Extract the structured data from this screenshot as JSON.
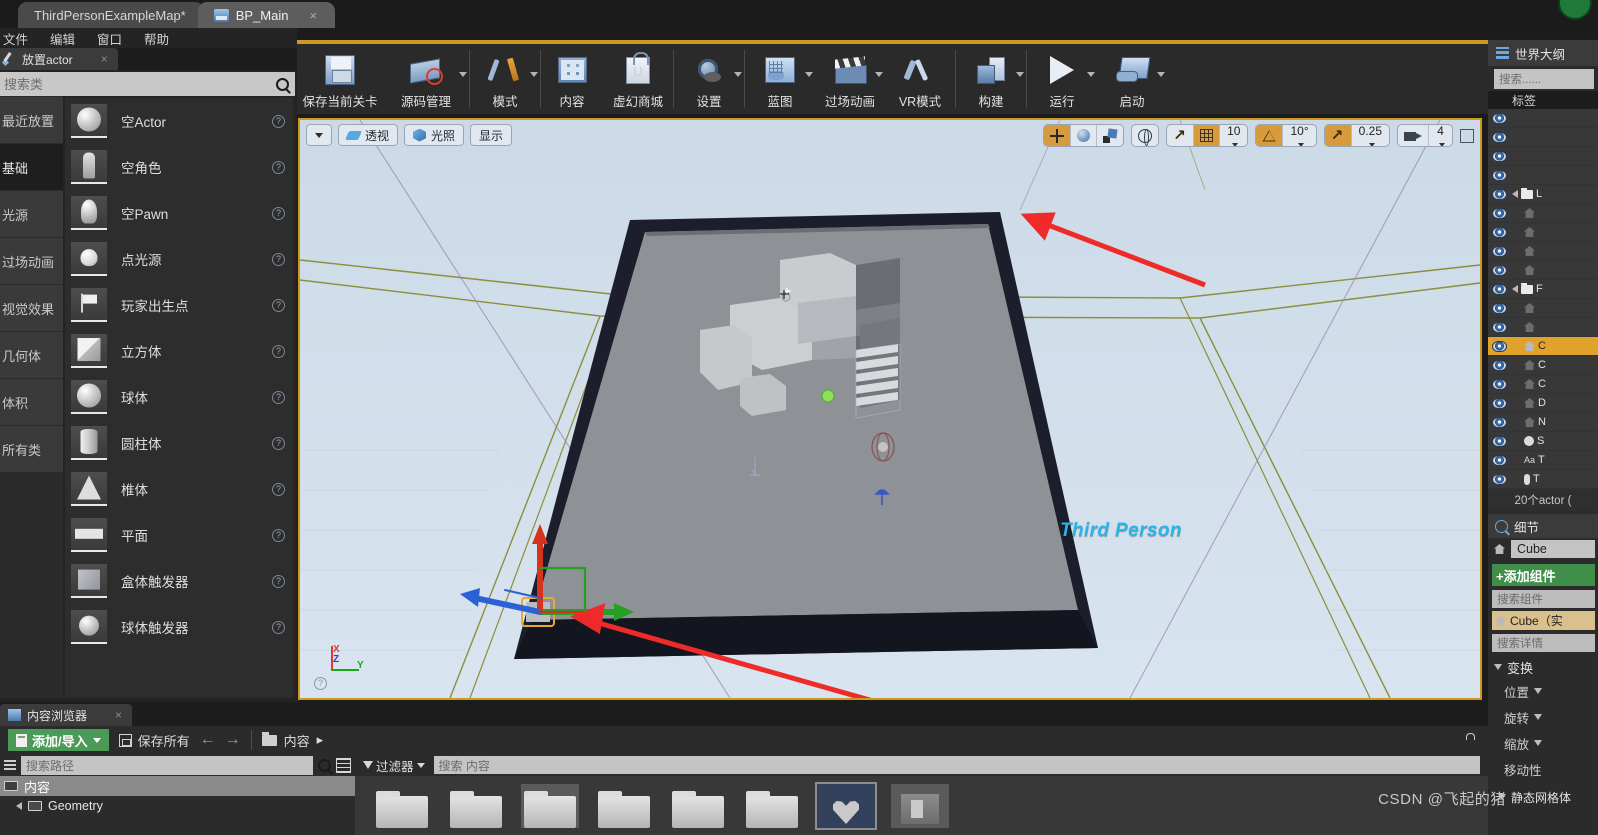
{
  "window": {
    "tabs": [
      {
        "label": "ThirdPersonExampleMap*",
        "icon": "map-tab-icon",
        "active": false,
        "close": "×"
      },
      {
        "label": "BP_Main",
        "icon": "blueprint-tab-icon",
        "active": true,
        "close": "×"
      }
    ]
  },
  "menubar": {
    "items": [
      "文件",
      "编辑",
      "窗口",
      "帮助"
    ]
  },
  "place_actors": {
    "tab_label": "放置actor",
    "tab_close": "×",
    "search_placeholder": "搜索类",
    "categories": [
      {
        "label": "最近放置",
        "selected": false
      },
      {
        "label": "基础",
        "selected": true
      },
      {
        "label": "光源",
        "selected": false
      },
      {
        "label": "过场动画",
        "selected": false
      },
      {
        "label": "视觉效果",
        "selected": false
      },
      {
        "label": "几何体",
        "selected": false
      },
      {
        "label": "体积",
        "selected": false
      },
      {
        "label": "所有类",
        "selected": false
      }
    ],
    "items": [
      {
        "label": "空Actor",
        "shape": "sphere",
        "help": "?"
      },
      {
        "label": "空角色",
        "shape": "person",
        "help": "?"
      },
      {
        "label": "空Pawn",
        "shape": "pawn",
        "help": "?"
      },
      {
        "label": "点光源",
        "shape": "bulb",
        "help": "?"
      },
      {
        "label": "玩家出生点",
        "shape": "flag",
        "help": "?"
      },
      {
        "label": "立方体",
        "shape": "cube",
        "help": "?"
      },
      {
        "label": "球体",
        "shape": "sphere",
        "help": "?"
      },
      {
        "label": "圆柱体",
        "shape": "cylinder",
        "help": "?"
      },
      {
        "label": "椎体",
        "shape": "cone",
        "help": "?"
      },
      {
        "label": "平面",
        "shape": "plane",
        "help": "?"
      },
      {
        "label": "盒体触发器",
        "shape": "box-trigger",
        "help": "?"
      },
      {
        "label": "球体触发器",
        "shape": "sphere-trigger",
        "help": "?"
      }
    ]
  },
  "toolbar": {
    "buttons": [
      {
        "label": "保存当前关卡",
        "icon": "save-level-icon",
        "caret": false
      },
      {
        "label": "源码管理",
        "icon": "source-control-icon",
        "caret": true
      },
      {
        "label": "模式",
        "icon": "modes-icon",
        "caret": true
      },
      {
        "label": "内容",
        "icon": "content-icon",
        "caret": false
      },
      {
        "label": "虚幻商城",
        "icon": "marketplace-icon",
        "caret": false
      },
      {
        "label": "设置",
        "icon": "settings-gear-icon",
        "caret": true
      },
      {
        "label": "蓝图",
        "icon": "blueprint-icon",
        "caret": true
      },
      {
        "label": "过场动画",
        "icon": "cinematics-icon",
        "caret": true
      },
      {
        "label": "VR模式",
        "icon": "vr-mode-icon",
        "caret": false
      },
      {
        "label": "构建",
        "icon": "build-icon",
        "caret": true
      },
      {
        "label": "运行",
        "icon": "play-icon",
        "caret": true
      },
      {
        "label": "启动",
        "icon": "launch-icon",
        "caret": true
      }
    ]
  },
  "viewport": {
    "left_buttons": [
      {
        "label": "",
        "icon": "chevron-down-icon"
      },
      {
        "label": "透视",
        "icon": "perspective-icon"
      },
      {
        "label": "光照",
        "icon": "lit-icon"
      },
      {
        "label": "显示",
        "icon": "show-icon"
      }
    ],
    "transform_modes": [
      {
        "icon": "move-tool-icon",
        "active": true
      },
      {
        "icon": "rotate-tool-icon",
        "active": false
      },
      {
        "icon": "scale-tool-icon",
        "active": false
      }
    ],
    "coordinate_space": {
      "icon": "world-space-globe-icon",
      "active": false
    },
    "grid_snap": {
      "icon": "grid-snap-icon",
      "value": "10",
      "active": true
    },
    "surface_snap": {
      "icon": "surface-snap-icon",
      "active": false
    },
    "rotation_snap": {
      "icon": "rotation-snap-icon",
      "value": "10°",
      "active": false
    },
    "scale_snap": {
      "icon": "scale-snap-icon",
      "value": "0.25",
      "active": true
    },
    "camera_speed": {
      "icon": "camera-speed-icon",
      "value": "4"
    },
    "maximize": {
      "icon": "maximize-viewport-icon"
    },
    "scene_label": "Third Person",
    "axis_labels": {
      "x": "X",
      "y": "Y",
      "z": "Z"
    },
    "help": "?"
  },
  "world_outliner": {
    "tab_label": "世界大纲",
    "search_placeholder": "搜索......",
    "column_header": "标签",
    "rows": [
      {
        "icon": "",
        "indent": 0,
        "label": "",
        "selected": false
      },
      {
        "icon": "",
        "indent": 0,
        "label": "",
        "selected": false
      },
      {
        "icon": "",
        "indent": 0,
        "label": "",
        "selected": false
      },
      {
        "icon": "",
        "indent": 0,
        "label": "",
        "selected": false
      },
      {
        "icon": "folder-icon",
        "indent": 0,
        "label": "L",
        "selected": false
      },
      {
        "icon": "light-icon",
        "indent": 1,
        "label": "",
        "selected": false
      },
      {
        "icon": "sky-light-icon",
        "indent": 1,
        "label": "",
        "selected": false
      },
      {
        "icon": "post-process-icon",
        "indent": 1,
        "label": "",
        "selected": false
      },
      {
        "icon": "directional-light-icon",
        "indent": 1,
        "label": "",
        "selected": false
      },
      {
        "icon": "folder-icon",
        "indent": 0,
        "label": "F",
        "selected": false
      },
      {
        "icon": "fog-icon",
        "indent": 1,
        "label": "",
        "selected": false
      },
      {
        "icon": "sphere-reflection-icon",
        "indent": 1,
        "label": "",
        "selected": false
      },
      {
        "icon": "house-icon",
        "indent": 1,
        "label": "C",
        "selected": true
      },
      {
        "icon": "house-icon",
        "indent": 1,
        "label": "C",
        "selected": false
      },
      {
        "icon": "house-icon",
        "indent": 1,
        "label": "C",
        "selected": false
      },
      {
        "icon": "question-actor-icon",
        "indent": 1,
        "label": "D",
        "selected": false
      },
      {
        "icon": "nav-mesh-icon",
        "indent": 1,
        "label": "N",
        "selected": false
      },
      {
        "icon": "sphere-icon",
        "indent": 1,
        "label": "S",
        "selected": false
      },
      {
        "icon": "text-render-icon",
        "indent": 1,
        "label": "T",
        "selected": false
      },
      {
        "icon": "pawn-icon",
        "indent": 1,
        "label": "T",
        "selected": false
      }
    ],
    "count_label": "20个actor ("
  },
  "details": {
    "tab_label": "细节",
    "actor_name": "Cube",
    "add_component_label": "+添加组件",
    "search_components_placeholder": "搜索组件",
    "component_row": "Cube（实",
    "search_details_placeholder": "搜索详情",
    "section_transform": "变换",
    "properties": [
      {
        "label": "位置",
        "caret": true
      },
      {
        "label": "旋转",
        "caret": true
      },
      {
        "label": "缩放",
        "caret": true
      },
      {
        "label": "移动性",
        "caret": false
      }
    ],
    "section_static_mesh": "静态网格体"
  },
  "content_browser": {
    "tab_label": "内容浏览器",
    "tab_close": "×",
    "add_import_label": "添加/导入",
    "save_all_label": "保存所有",
    "back_arrow": "←",
    "forward_arrow": "→",
    "breadcrumb": "内容",
    "breadcrumb_caret": "▸",
    "path_search_placeholder": "搜索路径",
    "tree": [
      {
        "label": "内容",
        "selected": true,
        "child": false
      },
      {
        "label": "Geometry",
        "selected": false,
        "child": true
      }
    ],
    "filter_label": "过滤器",
    "content_search_placeholder": "搜索 内容",
    "assets": [
      {
        "type": "folder",
        "selected": false
      },
      {
        "type": "folder",
        "selected": false
      },
      {
        "type": "folder",
        "selected": false
      },
      {
        "type": "folder",
        "selected": false
      },
      {
        "type": "folder",
        "selected": false
      },
      {
        "type": "folder",
        "selected": false
      },
      {
        "type": "heart-asset",
        "selected": true
      },
      {
        "type": "mesh-asset",
        "selected": false
      }
    ]
  },
  "watermark": "CSDN @飞起的猪",
  "colors": {
    "accent_orange": "#cf9a1e",
    "selection_orange": "#e0a22a",
    "add_green": "#4c9a57",
    "annotation_red": "#ee2b28",
    "label_cyan": "#2ab4e8"
  }
}
